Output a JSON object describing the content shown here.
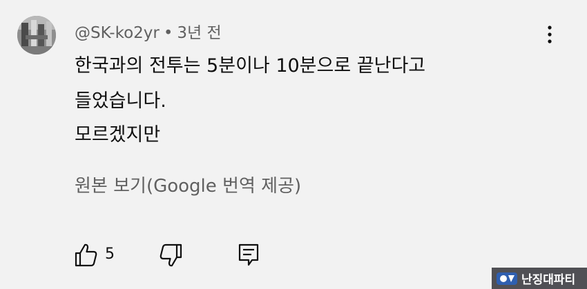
{
  "comment": {
    "handle": "@SK-ko2yr",
    "separator": "•",
    "time": "3년 전",
    "body_lines": [
      "한국과의 전투는 5분이나 10분으로 끝난다고",
      "들었습니다.",
      "모르겠지만"
    ],
    "see_original": "원본 보기(Google 번역 제공)"
  },
  "actions": {
    "like_icon": "thumbs-up-icon",
    "like_count": "5",
    "dislike_icon": "thumbs-down-icon",
    "reply_icon": "reply-icon",
    "more_icon": "more-vertical-icon"
  },
  "watermark": {
    "text": "난징대파티"
  },
  "colors": {
    "background": "#f2f2f2",
    "primary_text": "#0f0f0f",
    "secondary_text": "#606060"
  }
}
